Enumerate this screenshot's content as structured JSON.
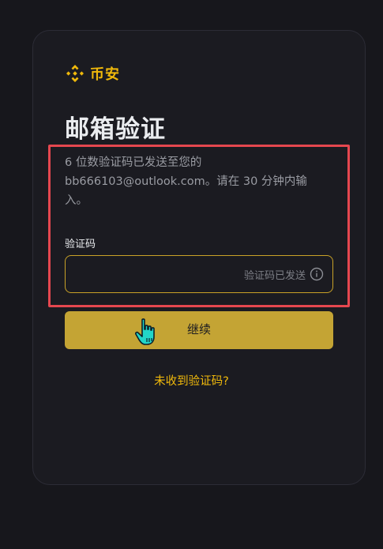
{
  "brand": {
    "name": "币安",
    "logo_icon": "binance-diamond-icon",
    "accent_color": "#f0b90b"
  },
  "page_title": "邮箱验证",
  "description": "6 位数验证码已发送至您的 bb666103@outlook.com。请在 30 分钟内输入。",
  "code_field": {
    "label": "验证码",
    "value": "",
    "status_text": "验证码已发送",
    "status_icon": "info-icon"
  },
  "continue_button": {
    "label": "继续",
    "color": "#c4a434"
  },
  "resend_link": "未收到验证码?",
  "highlight_color": "#e5474f",
  "cursor_icon": "hand-pointer-icon"
}
